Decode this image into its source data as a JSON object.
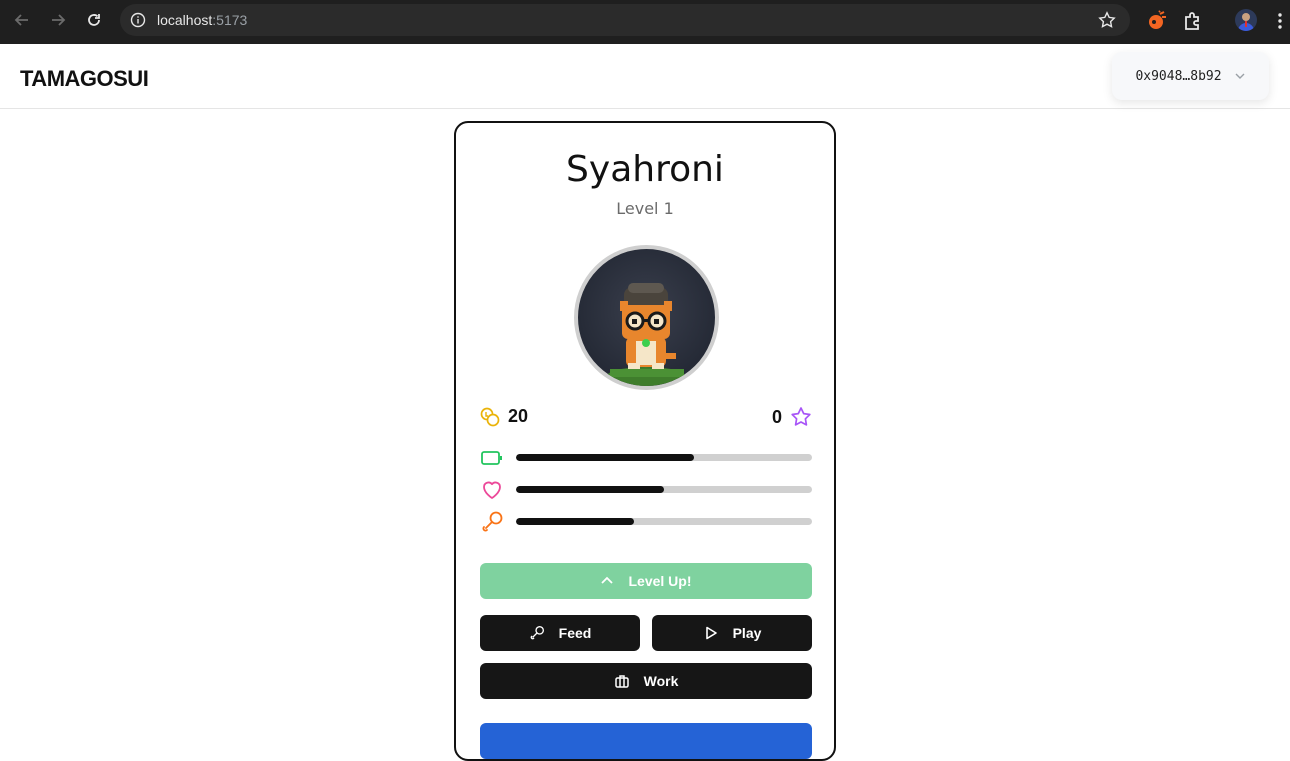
{
  "browser": {
    "url_host": "localhost",
    "url_port": ":5173"
  },
  "header": {
    "brand": "TAMAGOSUI",
    "wallet_address": "0x9048…8b92"
  },
  "pet": {
    "name": "Syahroni",
    "level_text": "Level 1",
    "coins": "20",
    "experience": "0",
    "stats": {
      "energy": 0.6,
      "happiness": 0.5,
      "hunger": 0.4
    }
  },
  "actions": {
    "level_up": "Level Up!",
    "feed": "Feed",
    "play": "Play",
    "work": "Work"
  },
  "colors": {
    "level_up_bg": "#7fd29f",
    "energy_icon": "#22c55e",
    "happiness_icon": "#ec4899",
    "hunger_icon": "#f97316",
    "coin_icon": "#eab308",
    "star_icon": "#a855f7",
    "bottom_button": "#2563d6"
  }
}
